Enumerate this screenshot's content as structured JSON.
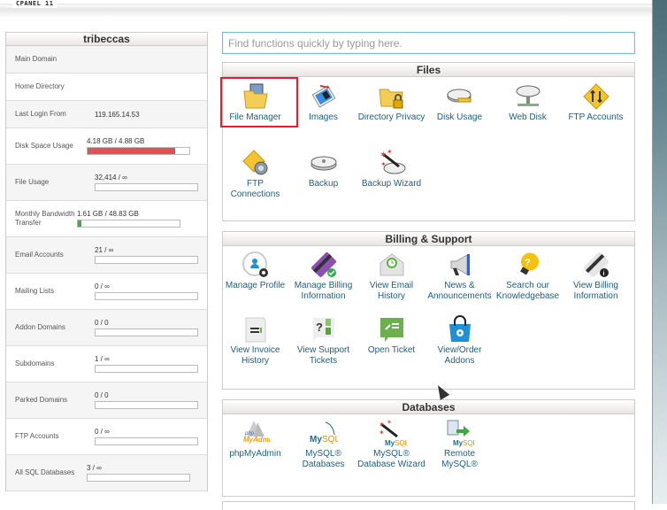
{
  "app": {
    "brand": "CPANEL 11"
  },
  "stats": {
    "username": "tribeccas",
    "rows": [
      {
        "label": "Main Domain",
        "value": "",
        "bar": null
      },
      {
        "label": "Home Directory",
        "value": "",
        "bar": null
      },
      {
        "label": "Last Login From",
        "value": "119.165.14.53",
        "bar": null
      },
      {
        "label": "Disk Space Usage",
        "value": "4.18 GB / 4.88 GB",
        "bar": {
          "percent": 85.7,
          "color": "#e05353"
        }
      },
      {
        "label": "File Usage",
        "value": "32,414 / ∞",
        "bar": {
          "percent": 0,
          "color": "#4caf50"
        }
      },
      {
        "label": "Monthly Bandwidth Transfer",
        "value": "1.61 GB / 48.83 GB",
        "bar": {
          "percent": 3.3,
          "color": "#3fae49"
        }
      },
      {
        "label": "Email Accounts",
        "value": "21 / ∞",
        "bar": {
          "percent": 0,
          "color": "#4caf50"
        }
      },
      {
        "label": "Mailing Lists",
        "value": "0 / ∞",
        "bar": {
          "percent": 0,
          "color": "#4caf50"
        }
      },
      {
        "label": "Addon Domains",
        "value": "0 / 0",
        "bar": {
          "percent": 0,
          "color": "#4caf50"
        }
      },
      {
        "label": "Subdomains",
        "value": "1 / ∞",
        "bar": {
          "percent": 0,
          "color": "#4caf50"
        }
      },
      {
        "label": "Parked Domains",
        "value": "0 / 0",
        "bar": {
          "percent": 0,
          "color": "#4caf50"
        }
      },
      {
        "label": "FTP Accounts",
        "value": "0 / ∞",
        "bar": {
          "percent": 0,
          "color": "#4caf50"
        }
      },
      {
        "label": "All SQL Databases",
        "value": "3 / ∞",
        "bar": {
          "percent": 0,
          "color": "#4caf50"
        }
      }
    ]
  },
  "search": {
    "placeholder": "Find functions quickly by typing here."
  },
  "sections": {
    "files": {
      "title": "Files",
      "items": [
        {
          "label": "File Manager",
          "icon": "file-manager-icon",
          "selected": true
        },
        {
          "label": "Images",
          "icon": "images-icon"
        },
        {
          "label": "Directory Privacy",
          "icon": "directory-privacy-icon"
        },
        {
          "label": "Disk Usage",
          "icon": "disk-usage-icon"
        },
        {
          "label": "Web Disk",
          "icon": "web-disk-icon"
        },
        {
          "label": "FTP Accounts",
          "icon": "ftp-accounts-icon"
        },
        {
          "label": "FTP Connections",
          "icon": "ftp-connections-icon"
        },
        {
          "label": "Backup",
          "icon": "backup-icon"
        },
        {
          "label": "Backup Wizard",
          "icon": "backup-wizard-icon"
        }
      ]
    },
    "billing": {
      "title": "Billing & Support",
      "items": [
        {
          "label": "Manage Profile",
          "icon": "manage-profile-icon"
        },
        {
          "label": "Manage Billing Information",
          "icon": "manage-billing-icon"
        },
        {
          "label": "View Email History",
          "icon": "email-history-icon"
        },
        {
          "label": "News & Announcements",
          "icon": "megaphone-icon"
        },
        {
          "label": "Search our Knowledgebase",
          "icon": "lightbulb-icon"
        },
        {
          "label": "View Billing Information",
          "icon": "billing-info-icon"
        },
        {
          "label": "View Invoice History",
          "icon": "invoice-icon"
        },
        {
          "label": "View Support Tickets",
          "icon": "support-tickets-icon"
        },
        {
          "label": "Open Ticket",
          "icon": "open-ticket-icon"
        },
        {
          "label": "View/Order Addons",
          "icon": "addons-bag-icon"
        }
      ]
    },
    "databases": {
      "title": "Databases",
      "items": [
        {
          "label": "phpMyAdmin",
          "icon": "phpmyadmin-icon"
        },
        {
          "label": "MySQL® Databases",
          "icon": "mysql-icon"
        },
        {
          "label": "MySQL® Database Wizard",
          "icon": "mysql-wizard-icon"
        },
        {
          "label": "Remote MySQL®",
          "icon": "remote-mysql-icon"
        }
      ]
    }
  }
}
